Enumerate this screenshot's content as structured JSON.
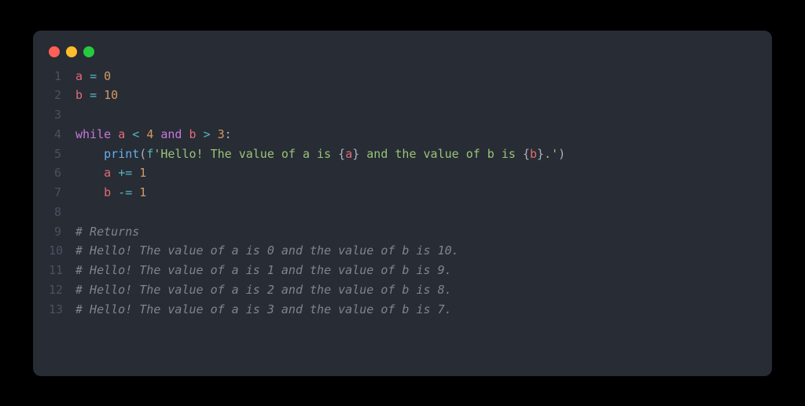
{
  "window": {
    "traffic_lights": [
      "close",
      "minimize",
      "zoom"
    ]
  },
  "code": {
    "lines": [
      {
        "n": 1,
        "tokens": [
          {
            "t": "a",
            "c": "tk-var"
          },
          {
            "t": " ",
            "c": "tk-plain"
          },
          {
            "t": "=",
            "c": "tk-op"
          },
          {
            "t": " ",
            "c": "tk-plain"
          },
          {
            "t": "0",
            "c": "tk-num"
          }
        ]
      },
      {
        "n": 2,
        "tokens": [
          {
            "t": "b",
            "c": "tk-var"
          },
          {
            "t": " ",
            "c": "tk-plain"
          },
          {
            "t": "=",
            "c": "tk-op"
          },
          {
            "t": " ",
            "c": "tk-plain"
          },
          {
            "t": "10",
            "c": "tk-num"
          }
        ]
      },
      {
        "n": 3,
        "tokens": []
      },
      {
        "n": 4,
        "tokens": [
          {
            "t": "while",
            "c": "tk-kw"
          },
          {
            "t": " ",
            "c": "tk-plain"
          },
          {
            "t": "a",
            "c": "tk-var"
          },
          {
            "t": " ",
            "c": "tk-plain"
          },
          {
            "t": "<",
            "c": "tk-op"
          },
          {
            "t": " ",
            "c": "tk-plain"
          },
          {
            "t": "4",
            "c": "tk-num"
          },
          {
            "t": " ",
            "c": "tk-plain"
          },
          {
            "t": "and",
            "c": "tk-kw"
          },
          {
            "t": " ",
            "c": "tk-plain"
          },
          {
            "t": "b",
            "c": "tk-var"
          },
          {
            "t": " ",
            "c": "tk-plain"
          },
          {
            "t": ">",
            "c": "tk-op"
          },
          {
            "t": " ",
            "c": "tk-plain"
          },
          {
            "t": "3",
            "c": "tk-num"
          },
          {
            "t": ":",
            "c": "tk-punct"
          }
        ]
      },
      {
        "n": 5,
        "tokens": [
          {
            "t": "    ",
            "c": "tk-plain"
          },
          {
            "t": "print",
            "c": "tk-func"
          },
          {
            "t": "(",
            "c": "tk-punct"
          },
          {
            "t": "f",
            "c": "tk-strprefix"
          },
          {
            "t": "'Hello! The value of a is ",
            "c": "tk-str"
          },
          {
            "t": "{",
            "c": "tk-punct"
          },
          {
            "t": "a",
            "c": "tk-interp"
          },
          {
            "t": "}",
            "c": "tk-punct"
          },
          {
            "t": " and the value of b is ",
            "c": "tk-str"
          },
          {
            "t": "{",
            "c": "tk-punct"
          },
          {
            "t": "b",
            "c": "tk-interp"
          },
          {
            "t": "}",
            "c": "tk-punct"
          },
          {
            "t": ".'",
            "c": "tk-str"
          },
          {
            "t": ")",
            "c": "tk-punct"
          }
        ]
      },
      {
        "n": 6,
        "tokens": [
          {
            "t": "    ",
            "c": "tk-plain"
          },
          {
            "t": "a",
            "c": "tk-var"
          },
          {
            "t": " ",
            "c": "tk-plain"
          },
          {
            "t": "+=",
            "c": "tk-op"
          },
          {
            "t": " ",
            "c": "tk-plain"
          },
          {
            "t": "1",
            "c": "tk-num"
          }
        ]
      },
      {
        "n": 7,
        "tokens": [
          {
            "t": "    ",
            "c": "tk-plain"
          },
          {
            "t": "b",
            "c": "tk-var"
          },
          {
            "t": " ",
            "c": "tk-plain"
          },
          {
            "t": "-=",
            "c": "tk-op"
          },
          {
            "t": " ",
            "c": "tk-plain"
          },
          {
            "t": "1",
            "c": "tk-num"
          }
        ]
      },
      {
        "n": 8,
        "tokens": []
      },
      {
        "n": 9,
        "tokens": [
          {
            "t": "# Returns",
            "c": "tk-comment"
          }
        ]
      },
      {
        "n": 10,
        "tokens": [
          {
            "t": "# Hello! The value of a is 0 and the value of b is 10.",
            "c": "tk-comment"
          }
        ]
      },
      {
        "n": 11,
        "tokens": [
          {
            "t": "# Hello! The value of a is 1 and the value of b is 9.",
            "c": "tk-comment"
          }
        ]
      },
      {
        "n": 12,
        "tokens": [
          {
            "t": "# Hello! The value of a is 2 and the value of b is 8.",
            "c": "tk-comment"
          }
        ]
      },
      {
        "n": 13,
        "tokens": [
          {
            "t": "# Hello! The value of a is 3 and the value of b is 7.",
            "c": "tk-comment"
          }
        ]
      }
    ]
  }
}
